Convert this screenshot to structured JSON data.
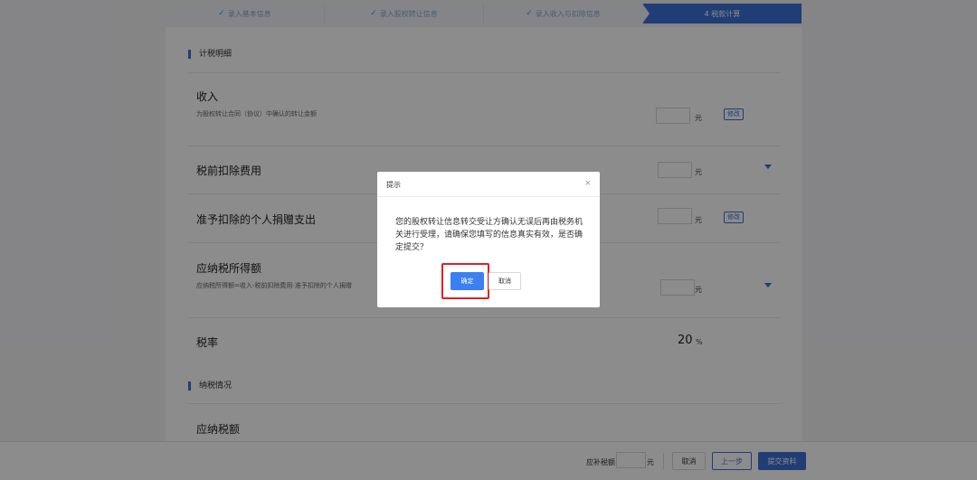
{
  "steps": [
    {
      "label": "录入基本信息",
      "done": true
    },
    {
      "label": "录入股权转让信息",
      "done": true
    },
    {
      "label": "录入收入与扣除信息",
      "done": true
    },
    {
      "label": "4  税款计算",
      "done": false
    }
  ],
  "tax_detail": {
    "section_title": "计税明细",
    "income": {
      "title": "收入",
      "desc": "为股权转让合同（协议）中确认的转让金额",
      "unit": "元",
      "action": "修改"
    },
    "pre_tax_deduction": {
      "title": "税前扣除费用",
      "unit": "元"
    },
    "donation_deduction": {
      "title": "准予扣除的个人捐赠支出",
      "unit": "元",
      "action": "修改"
    },
    "taxable_income": {
      "title": "应纳税所得额",
      "desc": "应纳税所得额=收入-税前扣除费用-准予扣除的个人捐赠",
      "unit": "元"
    },
    "tax_rate": {
      "title": "税率",
      "value": "20",
      "unit": "%"
    }
  },
  "tax_status": {
    "section_title": "纳税情况",
    "payable": {
      "title": "应纳税额"
    }
  },
  "footer": {
    "supplement_label": "应补税额",
    "unit": "元",
    "cancel": "取消",
    "prev": "上一步",
    "submit": "提交资料"
  },
  "dialog": {
    "title": "提示",
    "close": "×",
    "message": "您的股权转让信息转交受让方确认无误后再由税务机关进行受理，请确保您填写的信息真实有效，是否确定提交？",
    "ok": "确定",
    "cancel": "取消"
  },
  "colors": {
    "primary": "#3b6fd6",
    "highlight": "#e02020",
    "overlay": "rgba(0,0,0,0.45)"
  }
}
